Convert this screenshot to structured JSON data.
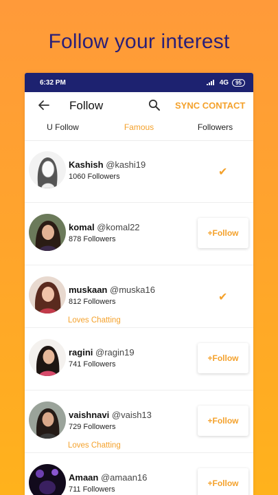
{
  "headline": "Follow your interest",
  "statusbar": {
    "time": "6:32 PM",
    "network": "4G",
    "battery": "95"
  },
  "appbar": {
    "title": "Follow",
    "sync_label": "SYNC CONTACT"
  },
  "tabs": [
    {
      "label": "U Follow"
    },
    {
      "label": "Famous"
    },
    {
      "label": "Followers"
    }
  ],
  "accent_color": "#f4a12b",
  "users": [
    {
      "name": "Kashish",
      "handle": "@kashi19",
      "followers": "1060 Followers",
      "tagline": "",
      "action": "✔"
    },
    {
      "name": "komal",
      "handle": "@komal22",
      "followers": "878 Followers",
      "tagline": "",
      "action": "+Follow"
    },
    {
      "name": "muskaan",
      "handle": "@muska16",
      "followers": "812 Followers",
      "tagline": "Loves Chatting",
      "action": "✔"
    },
    {
      "name": "ragini",
      "handle": "@ragin19",
      "followers": "741 Followers",
      "tagline": "",
      "action": "+Follow"
    },
    {
      "name": "vaishnavi",
      "handle": "@vaish13",
      "followers": "729 Followers",
      "tagline": "Loves Chatting",
      "action": "+Follow"
    },
    {
      "name": "Amaan",
      "handle": "@amaan16",
      "followers": "711 Followers",
      "tagline": "",
      "action": "+Follow"
    }
  ]
}
